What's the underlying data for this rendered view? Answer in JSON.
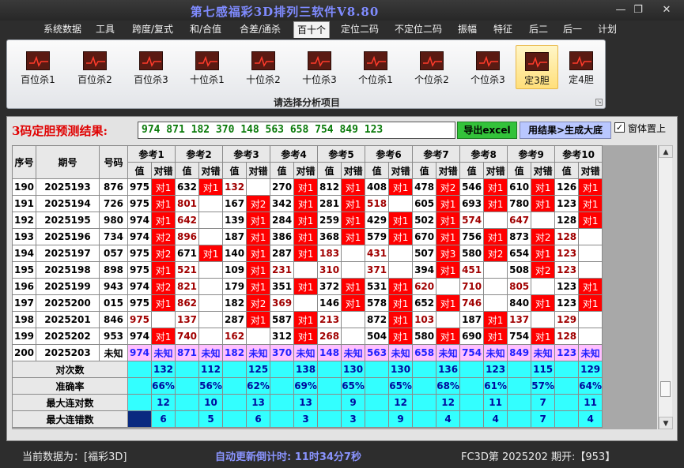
{
  "window": {
    "title": "第七感福彩3D排列三软件V8.80",
    "minimize_glyph": "—",
    "maximize_glyph": "❐",
    "close_glyph": "✕"
  },
  "menu": [
    "系统数据",
    "工具",
    "跨度/复式",
    "和/合值",
    "合差/通杀",
    "百十个",
    "定位二码",
    "不定位二码",
    "振幅",
    "特征",
    "后二",
    "后一",
    "计划"
  ],
  "menu_active": "百十个",
  "ribbon": {
    "buttons": [
      "百位杀1",
      "百位杀2",
      "百位杀3",
      "十位杀1",
      "十位杀2",
      "十位杀3",
      "个位杀1",
      "个位杀2",
      "个位杀3",
      "定3胆",
      "定4胆"
    ],
    "selected": "定3胆",
    "group_label": "请选择分析项目"
  },
  "prediction": {
    "label": "3码定胆预测结果:",
    "value": "974 871 182 370 148 563 658 754 849 123",
    "export_button": "导出excel",
    "generate_button": "用结果>生成大底",
    "always_on_top_label": "窗体置上",
    "always_on_top_checked": true,
    "check_glyph": "✓"
  },
  "table": {
    "headers": {
      "seq": "序号",
      "period": "期号",
      "code": "号码",
      "value": "值",
      "result": "对错"
    },
    "refs": [
      "参考1",
      "参考2",
      "参考3",
      "参考4",
      "参考5",
      "参考6",
      "参考7",
      "参考8",
      "参考9",
      "参考10"
    ],
    "rows": [
      {
        "seq": "190",
        "period": "2025193",
        "code": "876",
        "cells": [
          [
            "975",
            "对1"
          ],
          [
            "632",
            "对1"
          ],
          [
            "132",
            ""
          ],
          [
            "270",
            "对1"
          ],
          [
            "812",
            "对1"
          ],
          [
            "408",
            "对1"
          ],
          [
            "478",
            "对2"
          ],
          [
            "546",
            "对1"
          ],
          [
            "610",
            "对1"
          ],
          [
            "126",
            "对1"
          ]
        ]
      },
      {
        "seq": "191",
        "period": "2025194",
        "code": "726",
        "cells": [
          [
            "975",
            "对1"
          ],
          [
            "801",
            ""
          ],
          [
            "167",
            "对2"
          ],
          [
            "342",
            "对1"
          ],
          [
            "281",
            "对1"
          ],
          [
            "518",
            ""
          ],
          [
            "605",
            "对1"
          ],
          [
            "693",
            "对1"
          ],
          [
            "780",
            "对1"
          ],
          [
            "123",
            "对1"
          ]
        ]
      },
      {
        "seq": "192",
        "period": "2025195",
        "code": "980",
        "cells": [
          [
            "974",
            "对1"
          ],
          [
            "642",
            ""
          ],
          [
            "139",
            "对1"
          ],
          [
            "284",
            "对1"
          ],
          [
            "259",
            "对1"
          ],
          [
            "429",
            "对1"
          ],
          [
            "502",
            "对1"
          ],
          [
            "574",
            ""
          ],
          [
            "647",
            ""
          ],
          [
            "128",
            "对1"
          ]
        ]
      },
      {
        "seq": "193",
        "period": "2025196",
        "code": "734",
        "cells": [
          [
            "974",
            "对2"
          ],
          [
            "896",
            ""
          ],
          [
            "187",
            "对1"
          ],
          [
            "386",
            "对1"
          ],
          [
            "368",
            "对1"
          ],
          [
            "579",
            "对1"
          ],
          [
            "670",
            "对1"
          ],
          [
            "756",
            "对1"
          ],
          [
            "873",
            "对2"
          ],
          [
            "128",
            ""
          ]
        ]
      },
      {
        "seq": "194",
        "period": "2025197",
        "code": "057",
        "cells": [
          [
            "975",
            "对2"
          ],
          [
            "671",
            "对1"
          ],
          [
            "140",
            "对1"
          ],
          [
            "287",
            "对1"
          ],
          [
            "183",
            ""
          ],
          [
            "431",
            ""
          ],
          [
            "507",
            "对3"
          ],
          [
            "580",
            "对2"
          ],
          [
            "654",
            "对1"
          ],
          [
            "123",
            ""
          ]
        ]
      },
      {
        "seq": "195",
        "period": "2025198",
        "code": "898",
        "cells": [
          [
            "975",
            "对1"
          ],
          [
            "521",
            ""
          ],
          [
            "109",
            "对1"
          ],
          [
            "231",
            ""
          ],
          [
            "310",
            ""
          ],
          [
            "371",
            ""
          ],
          [
            "394",
            "对1"
          ],
          [
            "451",
            ""
          ],
          [
            "508",
            "对2"
          ],
          [
            "123",
            ""
          ]
        ]
      },
      {
        "seq": "196",
        "period": "2025199",
        "code": "943",
        "cells": [
          [
            "974",
            "对2"
          ],
          [
            "821",
            ""
          ],
          [
            "179",
            "对1"
          ],
          [
            "351",
            "对1"
          ],
          [
            "372",
            "对1"
          ],
          [
            "531",
            "对1"
          ],
          [
            "620",
            ""
          ],
          [
            "710",
            ""
          ],
          [
            "805",
            ""
          ],
          [
            "123",
            "对1"
          ]
        ]
      },
      {
        "seq": "197",
        "period": "2025200",
        "code": "015",
        "cells": [
          [
            "975",
            "对1"
          ],
          [
            "862",
            ""
          ],
          [
            "182",
            "对2"
          ],
          [
            "369",
            ""
          ],
          [
            "146",
            "对1"
          ],
          [
            "578",
            "对1"
          ],
          [
            "652",
            "对1"
          ],
          [
            "746",
            ""
          ],
          [
            "840",
            "对1"
          ],
          [
            "123",
            "对1"
          ]
        ]
      },
      {
        "seq": "198",
        "period": "2025201",
        "code": "846",
        "cells": [
          [
            "975",
            ""
          ],
          [
            "137",
            ""
          ],
          [
            "287",
            "对1"
          ],
          [
            "587",
            "对1"
          ],
          [
            "213",
            ""
          ],
          [
            "872",
            "对1"
          ],
          [
            "103",
            ""
          ],
          [
            "187",
            "对1"
          ],
          [
            "137",
            ""
          ],
          [
            "129",
            ""
          ]
        ]
      },
      {
        "seq": "199",
        "period": "2025202",
        "code": "953",
        "cells": [
          [
            "974",
            "对1"
          ],
          [
            "740",
            ""
          ],
          [
            "162",
            ""
          ],
          [
            "312",
            "对1"
          ],
          [
            "268",
            ""
          ],
          [
            "504",
            "对1"
          ],
          [
            "580",
            "对1"
          ],
          [
            "690",
            "对1"
          ],
          [
            "754",
            "对1"
          ],
          [
            "128",
            ""
          ]
        ]
      }
    ],
    "pending": {
      "seq": "200",
      "period": "2025203",
      "code": "未知",
      "cells": [
        [
          "974",
          "未知"
        ],
        [
          "871",
          "未知"
        ],
        [
          "182",
          "未知"
        ],
        [
          "370",
          "未知"
        ],
        [
          "148",
          "未知"
        ],
        [
          "563",
          "未知"
        ],
        [
          "658",
          "未知"
        ],
        [
          "754",
          "未知"
        ],
        [
          "849",
          "未知"
        ],
        [
          "123",
          "未知"
        ]
      ]
    },
    "stats": [
      {
        "label": "对次数",
        "values": [
          "132",
          "112",
          "125",
          "138",
          "130",
          "130",
          "136",
          "123",
          "115",
          "129"
        ]
      },
      {
        "label": "准确率",
        "values": [
          "66%",
          "56%",
          "62%",
          "69%",
          "65%",
          "65%",
          "68%",
          "61%",
          "57%",
          "64%"
        ]
      },
      {
        "label": "最大连对数",
        "values": [
          "12",
          "10",
          "13",
          "13",
          "9",
          "12",
          "12",
          "11",
          "7",
          "11"
        ]
      },
      {
        "label": "最大连错数",
        "values": [
          "6",
          "5",
          "6",
          "3",
          "3",
          "9",
          "4",
          "4",
          "7",
          "4"
        ]
      }
    ]
  },
  "scrollbar": {
    "up_glyph": "▲",
    "down_glyph": "▼",
    "thumb_position": 0.92
  },
  "status": {
    "current_data": "当前数据为：[福彩3D]",
    "countdown": "自动更新倒计时:  11时34分7秒",
    "issue": "FC3D第 2025202 期开:【953】"
  }
}
